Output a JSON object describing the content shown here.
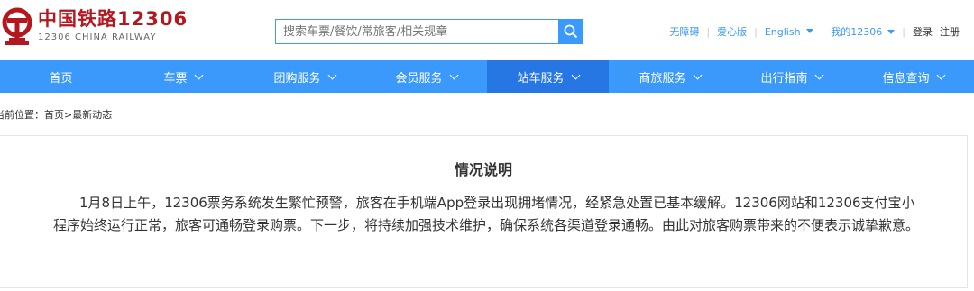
{
  "brand": {
    "name_cn": "中国铁路12306",
    "name_en": "12306 CHINA RAILWAY",
    "color": "#b4181e"
  },
  "search": {
    "placeholder": "搜索车票/餐饮/常旅客/相关规章",
    "icon": "search-icon"
  },
  "top_links": {
    "accessible": "无障碍",
    "elder": "爱心版",
    "language": "English",
    "my": "我的12306",
    "login": "登录",
    "register": "注册"
  },
  "nav": [
    {
      "label": "首页",
      "dropdown": false
    },
    {
      "label": "车票",
      "dropdown": true
    },
    {
      "label": "团购服务",
      "dropdown": true
    },
    {
      "label": "会员服务",
      "dropdown": true
    },
    {
      "label": "站车服务",
      "dropdown": true,
      "active": true
    },
    {
      "label": "商旅服务",
      "dropdown": true
    },
    {
      "label": "出行指南",
      "dropdown": true
    },
    {
      "label": "信息查询",
      "dropdown": true
    }
  ],
  "breadcrumb": "当前位置：首页>最新动态",
  "article": {
    "title": "情况说明",
    "body": "1月8日上午，12306票务系统发生繁忙预警，旅客在手机端App登录出现拥堵情况，经紧急处置已基本缓解。12306网站和12306支付宝小程序始终运行正常，旅客可通畅登录购票。下一步，将持续加强技术维护，确保系统各渠道登录通畅。由此对旅客购票带来的不便表示诚挚歉意。"
  },
  "colors": {
    "primary": "#3b99fc",
    "nav_active": "#2676e3"
  }
}
